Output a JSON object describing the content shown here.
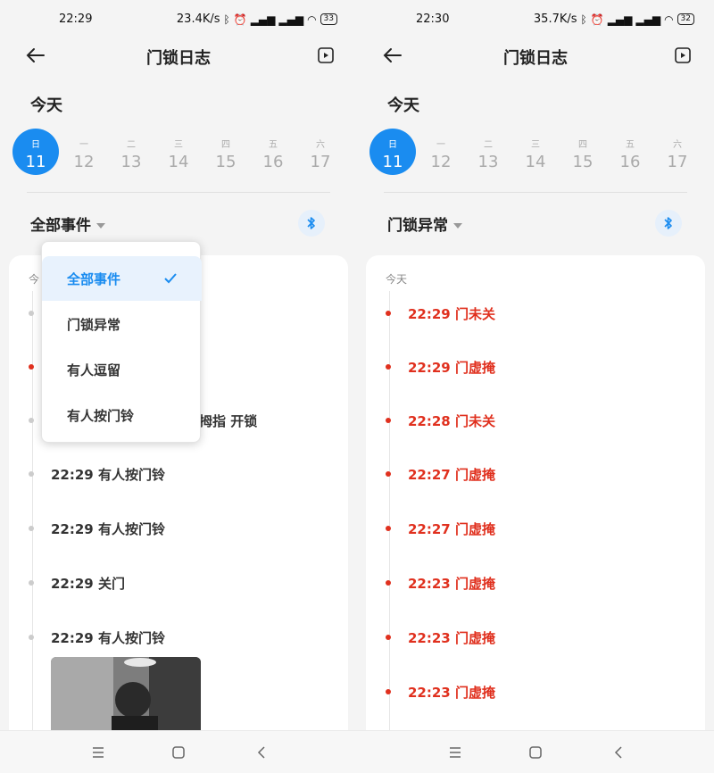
{
  "left": {
    "status": {
      "time": "22:29",
      "speed": "23.4K/s",
      "battery": "33"
    },
    "header": {
      "title": "门锁日志"
    },
    "today_label": "今天",
    "week": [
      {
        "wk": "日",
        "num": "11",
        "selected": true
      },
      {
        "wk": "一",
        "num": "12"
      },
      {
        "wk": "二",
        "num": "13"
      },
      {
        "wk": "三",
        "num": "14"
      },
      {
        "wk": "四",
        "num": "15"
      },
      {
        "wk": "五",
        "num": "16"
      },
      {
        "wk": "六",
        "num": "17"
      }
    ],
    "filter_label": "全部事件",
    "section_label": "今",
    "events": [
      {
        "text": ""
      },
      {
        "text": ""
      },
      {
        "text": "拇指 开锁"
      },
      {
        "text": "22:29  有人按门铃"
      },
      {
        "text": "22:29  有人按门铃"
      },
      {
        "text": "22:29  关门"
      },
      {
        "text": "22:29  有人按门铃"
      }
    ],
    "dropdown": [
      {
        "label": "全部事件",
        "selected": true
      },
      {
        "label": "门锁异常"
      },
      {
        "label": "有人逗留"
      },
      {
        "label": "有人按门铃"
      }
    ]
  },
  "right": {
    "status": {
      "time": "22:30",
      "speed": "35.7K/s",
      "battery": "32"
    },
    "header": {
      "title": "门锁日志"
    },
    "today_label": "今天",
    "week": [
      {
        "wk": "日",
        "num": "11",
        "selected": true
      },
      {
        "wk": "一",
        "num": "12"
      },
      {
        "wk": "二",
        "num": "13"
      },
      {
        "wk": "三",
        "num": "14"
      },
      {
        "wk": "四",
        "num": "15"
      },
      {
        "wk": "五",
        "num": "16"
      },
      {
        "wk": "六",
        "num": "17"
      }
    ],
    "filter_label": "门锁异常",
    "section_label": "今天",
    "events": [
      {
        "text": "22:29  门未关"
      },
      {
        "text": "22:29  门虚掩"
      },
      {
        "text": "22:28  门未关"
      },
      {
        "text": "22:27  门虚掩"
      },
      {
        "text": "22:27  门虚掩"
      },
      {
        "text": "22:23  门虚掩"
      },
      {
        "text": "22:23  门虚掩"
      },
      {
        "text": "22:23  门虚掩"
      }
    ]
  },
  "colors": {
    "accent": "#1a8cf0",
    "alert": "#e0301e"
  },
  "icons": {
    "back": "arrow-left-icon",
    "export": "video-file-icon",
    "bluetooth": "bluetooth-icon",
    "check": "check-icon"
  }
}
